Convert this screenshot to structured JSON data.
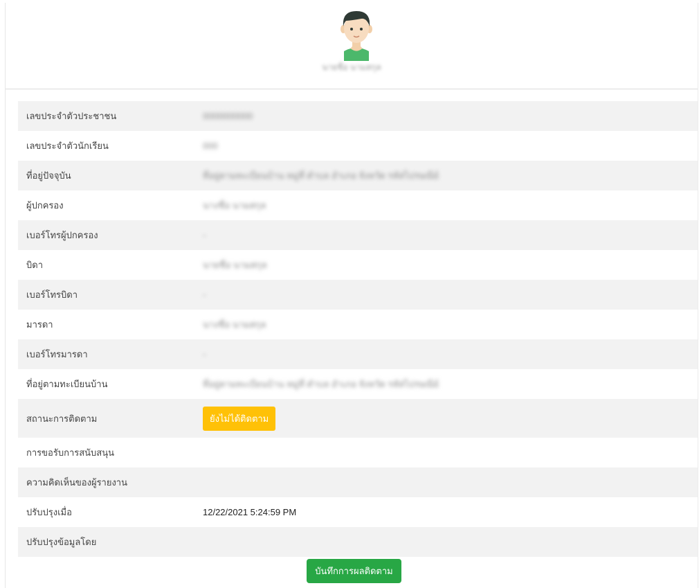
{
  "profile": {
    "student_name": "นายชื่อ นามสกุล"
  },
  "info_rows": [
    {
      "label": "เลขประจำตัวประชาชน",
      "value": "0000000000",
      "blurred": true
    },
    {
      "label": "เลขประจำตัวนักเรียน",
      "value": "000",
      "blurred": true
    },
    {
      "label": "ที่อยู่ปัจจุบัน",
      "value": "ที่อยู่ตามทะเบียนบ้าน หมู่ที่ ตำบล อำเภอ จังหวัด รหัสไปรษณีย์",
      "blurred": true
    },
    {
      "label": "ผู้ปกครอง",
      "value": "นางชื่อ นามสกุล",
      "blurred": true
    },
    {
      "label": "เบอร์โทรผู้ปกครอง",
      "value": "-",
      "blurred": true
    },
    {
      "label": "บิดา",
      "value": "นายชื่อ นามสกุล",
      "blurred": true
    },
    {
      "label": "เบอร์โทรบิดา",
      "value": "-",
      "blurred": true
    },
    {
      "label": "มารดา",
      "value": "นางชื่อ นามสกุล",
      "blurred": true
    },
    {
      "label": "เบอร์โทรมารดา",
      "value": "-",
      "blurred": true
    },
    {
      "label": "ที่อยู่ตามทะเบียนบ้าน",
      "value": "ที่อยู่ตามทะเบียนบ้าน หมู่ที่ ตำบล อำเภอ จังหวัด รหัสไปรษณีย์",
      "blurred": true
    },
    {
      "label": "สถานะการติดตาม",
      "value": "ยังไม่ได้ติดตาม",
      "badge": true
    },
    {
      "label": "การขอรับการสนับสนุน",
      "value": ""
    },
    {
      "label": "ความคิดเห็นของผู้รายงาน",
      "value": ""
    },
    {
      "label": "ปรับปรุงเมื่อ",
      "value": "12/22/2021 5:24:59 PM"
    },
    {
      "label": "ปรับปรุงข้อมูลโดย",
      "value": ""
    }
  ],
  "colors": {
    "status_badge": "#ffc107",
    "save_button": "#28a745",
    "row_stripe": "#f2f2f2"
  },
  "save_button_label": "บันทึกการผลติดตาม"
}
